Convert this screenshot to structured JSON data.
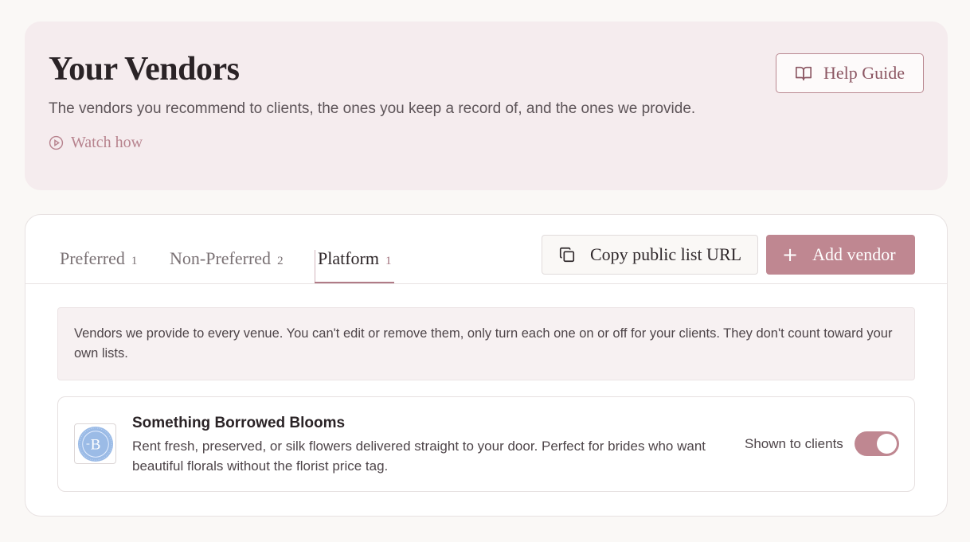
{
  "header": {
    "title": "Your Vendors",
    "subtitle": "The vendors you recommend to clients, the ones you keep a record of, and the ones we provide.",
    "watch_label": "Watch how",
    "help_label": "Help Guide"
  },
  "tabs": [
    {
      "label": "Preferred",
      "count": "1"
    },
    {
      "label": "Non-Preferred",
      "count": "2"
    },
    {
      "label": "Platform",
      "count": "1"
    }
  ],
  "active_tab": "Platform",
  "toolbar": {
    "copy_label": "Copy public list URL",
    "add_label": "Add vendor"
  },
  "notice": "Vendors we provide to every venue. You can't edit or remove them, only turn each one on or off for your clients. They don't count toward your own lists.",
  "vendors": [
    {
      "name": "Something Borrowed Blooms",
      "description": "Rent fresh, preserved, or silk flowers delivered straight to your door. Perfect for brides who want beautiful florals without the florist price tag.",
      "status_label": "Shown to clients",
      "shown": true,
      "logo_letter": "B"
    }
  ],
  "colors": {
    "accent": "#bf8791",
    "hero_bg": "#f5ecee",
    "logo_blue": "#8fb0e0"
  },
  "icons": {
    "watch": "play-circle-icon",
    "help": "book-open-icon",
    "copy": "copy-icon",
    "add": "plus-icon"
  }
}
